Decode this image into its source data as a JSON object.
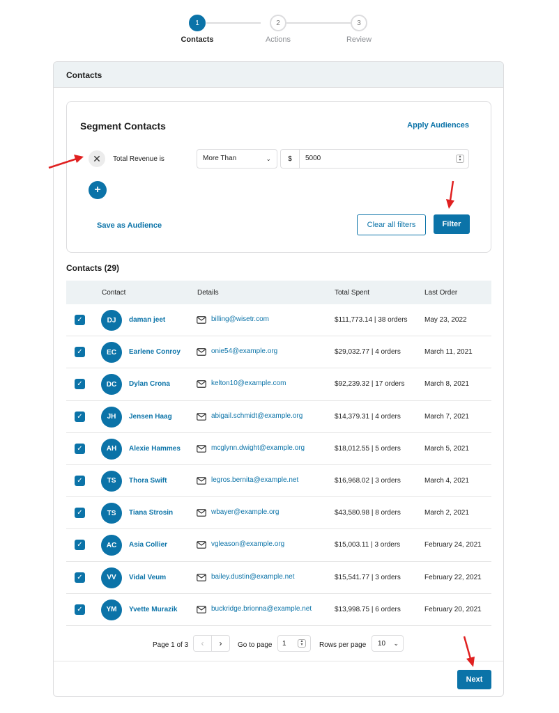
{
  "stepper": {
    "steps": [
      {
        "number": "1",
        "label": "Contacts"
      },
      {
        "number": "2",
        "label": "Actions"
      },
      {
        "number": "3",
        "label": "Review"
      }
    ]
  },
  "card": {
    "title": "Contacts"
  },
  "segment": {
    "title": "Segment Contacts",
    "apply_label": "Apply Audiences",
    "filter_label": "Total Revenue is",
    "operator": "More Than",
    "currency": "$",
    "amount": "5000",
    "save_label": "Save as Audience",
    "clear_label": "Clear all filters",
    "filter_button": "Filter"
  },
  "contacts": {
    "heading": "Contacts (29)",
    "columns": [
      "Contact",
      "Details",
      "Total Spent",
      "Last Order"
    ],
    "rows": [
      {
        "initials": "DJ",
        "name": "daman jeet",
        "email": "billing@wisetr.com",
        "spent": "$111,773.14 | 38 orders",
        "last": "May 23, 2022"
      },
      {
        "initials": "EC",
        "name": "Earlene Conroy",
        "email": "onie54@example.org",
        "spent": "$29,032.77 | 4 orders",
        "last": "March 11, 2021"
      },
      {
        "initials": "DC",
        "name": "Dylan Crona",
        "email": "kelton10@example.com",
        "spent": "$92,239.32 | 17 orders",
        "last": "March 8, 2021"
      },
      {
        "initials": "JH",
        "name": "Jensen Haag",
        "email": "abigail.schmidt@example.org",
        "spent": "$14,379.31 | 4 orders",
        "last": "March 7, 2021"
      },
      {
        "initials": "AH",
        "name": "Alexie Hammes",
        "email": "mcglynn.dwight@example.org",
        "spent": "$18,012.55 | 5 orders",
        "last": "March 5, 2021"
      },
      {
        "initials": "TS",
        "name": "Thora Swift",
        "email": "legros.bernita@example.net",
        "spent": "$16,968.02 | 3 orders",
        "last": "March 4, 2021"
      },
      {
        "initials": "TS",
        "name": "Tiana Strosin",
        "email": "wbayer@example.org",
        "spent": "$43,580.98 | 8 orders",
        "last": "March 2, 2021"
      },
      {
        "initials": "AC",
        "name": "Asia Collier",
        "email": "vgleason@example.org",
        "spent": "$15,003.11 | 3 orders",
        "last": "February 24, 2021"
      },
      {
        "initials": "VV",
        "name": "Vidal Veum",
        "email": "bailey.dustin@example.net",
        "spent": "$15,541.77 | 3 orders",
        "last": "February 22, 2021"
      },
      {
        "initials": "YM",
        "name": "Yvette Murazik",
        "email": "buckridge.brionna@example.net",
        "spent": "$13,998.75 | 6 orders",
        "last": "February 20, 2021"
      }
    ]
  },
  "pagination": {
    "page_text": "Page 1 of 3",
    "prev_icon": "chevron-left-icon",
    "next_icon": "chevron-right-icon",
    "goto_label": "Go to page",
    "goto_value": "1",
    "rows_label": "Rows per page",
    "rows_value": "10"
  },
  "footer": {
    "next_label": "Next"
  },
  "colors": {
    "primary": "#0b73a8",
    "header_bg": "#edf2f4",
    "annotation": "#e02020"
  }
}
